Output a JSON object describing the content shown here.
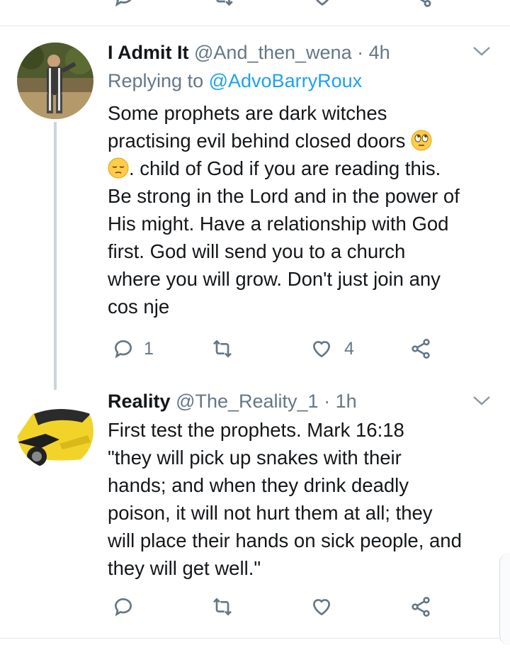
{
  "top_actions": [
    "reply-icon",
    "retweet-icon",
    "like-icon",
    "share-icon"
  ],
  "tweets": [
    {
      "name": "I Admit It",
      "handle": "@And_then_wena",
      "time": "· 4h",
      "replying_prefix": "Replying to",
      "replying_handle": "@AdvoBarryRoux",
      "body_part1": "Some prophets are dark witches\npractising evil behind closed doors ",
      "body_part2": "\n",
      "body_part3": ". child of God if you are reading this.\nBe strong in the Lord and in the power of\nHis might. Have a relationship with God\nfirst. God will send you to a church\nwhere you will grow. Don't just join any\ncos nje",
      "emojis": [
        "eye-roll-emoji",
        "pensive-emoji"
      ],
      "reply_count": "1",
      "like_count": "4"
    },
    {
      "name": "Reality",
      "handle": "@The_Reality_1",
      "time": "· 1h",
      "body": "First test the prophets. Mark 16:18\n\"they will pick up snakes with their\nhands; and when they drink deadly\npoison, it will not hurt them at all; they\nwill place their hands on sick people, and\nthey will get well.\""
    }
  ],
  "colors": {
    "link": "#1da1f2",
    "muted": "#657786",
    "text": "#14171a",
    "divider": "#e1e8ed"
  }
}
